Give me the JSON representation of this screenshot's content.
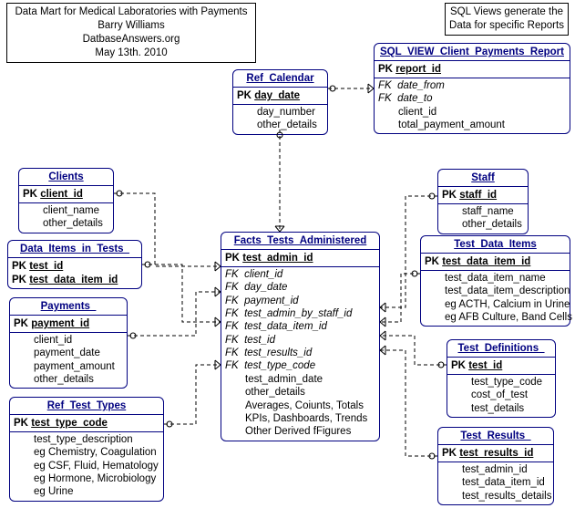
{
  "info_title": {
    "line1": "Data Mart for Medical Laboratories with Payments",
    "line2": "Barry Williams",
    "line3": "DatbaseAnswers.org",
    "line4": "May 13th. 2010"
  },
  "info_sql": {
    "line1": "SQL Views generate the",
    "line2": "Data for specific Reports"
  },
  "entities": {
    "ref_calendar": {
      "title": "Ref_Calendar",
      "pk_field": "day_date",
      "fields": [
        "day_number",
        "other_details"
      ]
    },
    "sql_view": {
      "title": "SQL_VIEW_Client_Payments_Report",
      "pk_field": "report_id",
      "fk_fields": [
        "date_from",
        "date_to"
      ],
      "fields": [
        "client_id",
        "total_payment_amount"
      ]
    },
    "clients": {
      "title": "Clients",
      "pk_field": "client_id",
      "fields": [
        "client_name",
        "other_details"
      ]
    },
    "data_items_in_tests": {
      "title": "Data_Items_in_Tests_",
      "pk_field1": "test_id",
      "pk_field2": "test_data_item_id"
    },
    "payments": {
      "title": "Payments_",
      "pk_field": "payment_id",
      "fields": [
        "client_id",
        "payment_date",
        "payment_amount",
        "other_details"
      ]
    },
    "ref_test_types": {
      "title": "Ref_Test_Types",
      "pk_field": "test_type_code",
      "fields": [
        "test_type_description",
        "eg Chemistry, Coagulation",
        "eg CSF, Fluid, Hematology",
        "eg Hormone, Microbiology",
        "eg Urine"
      ]
    },
    "facts": {
      "title": "Facts_Tests_Administered",
      "pk_field": "test_admin_id",
      "fk_fields": [
        "client_id",
        "day_date",
        "payment_id",
        "test_admin_by_staff_id",
        "test_data_item_id",
        "test_id",
        "test_results_id",
        "test_type_code"
      ],
      "fields": [
        "test_admin_date",
        "other_details",
        "Averages, Coiunts, Totals",
        "KPIs, Dashboards, Trends",
        "Other Derived fFigures"
      ]
    },
    "staff": {
      "title": "Staff",
      "pk_field": "staff_id",
      "fields": [
        "staff_name",
        "other_details"
      ]
    },
    "test_data_items": {
      "title": "Test_Data_Items",
      "pk_field": "test_data_item_id",
      "fields": [
        "test_data_item_name",
        "test_data_item_description",
        "eg ACTH, Calcium in Urine",
        "eg AFB Culture, Band Cells"
      ]
    },
    "test_definitions": {
      "title": "Test_Definitions_",
      "pk_field": "test_id",
      "fields": [
        "test_type_code",
        "cost_of_test",
        "test_details"
      ]
    },
    "test_results": {
      "title": "Test_Results_",
      "pk_field": "test_results_id",
      "fields": [
        "test_admin_id",
        "test_data_item_id",
        "test_results_details"
      ]
    }
  },
  "labels": {
    "pk": "PK",
    "fk": "FK"
  }
}
